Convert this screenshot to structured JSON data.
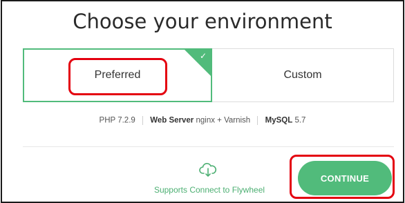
{
  "page": {
    "title": "Choose your environment"
  },
  "options": {
    "preferred_label": "Preferred",
    "custom_label": "Custom",
    "check_glyph": "✓"
  },
  "specs": {
    "php_label": "PHP",
    "php_version": "7.2.9",
    "web_server_label": "Web Server",
    "web_server_value": "nginx + Varnish",
    "mysql_label": "MySQL",
    "mysql_version": "5.7"
  },
  "footer": {
    "flywheel_icon": "cloud-arrow-icon",
    "flywheel_label": "Supports Connect to Flywheel",
    "continue_label": "CONTINUE"
  },
  "colors": {
    "accent": "#51bb7b",
    "highlight": "#e4000f",
    "text": "#333333"
  }
}
